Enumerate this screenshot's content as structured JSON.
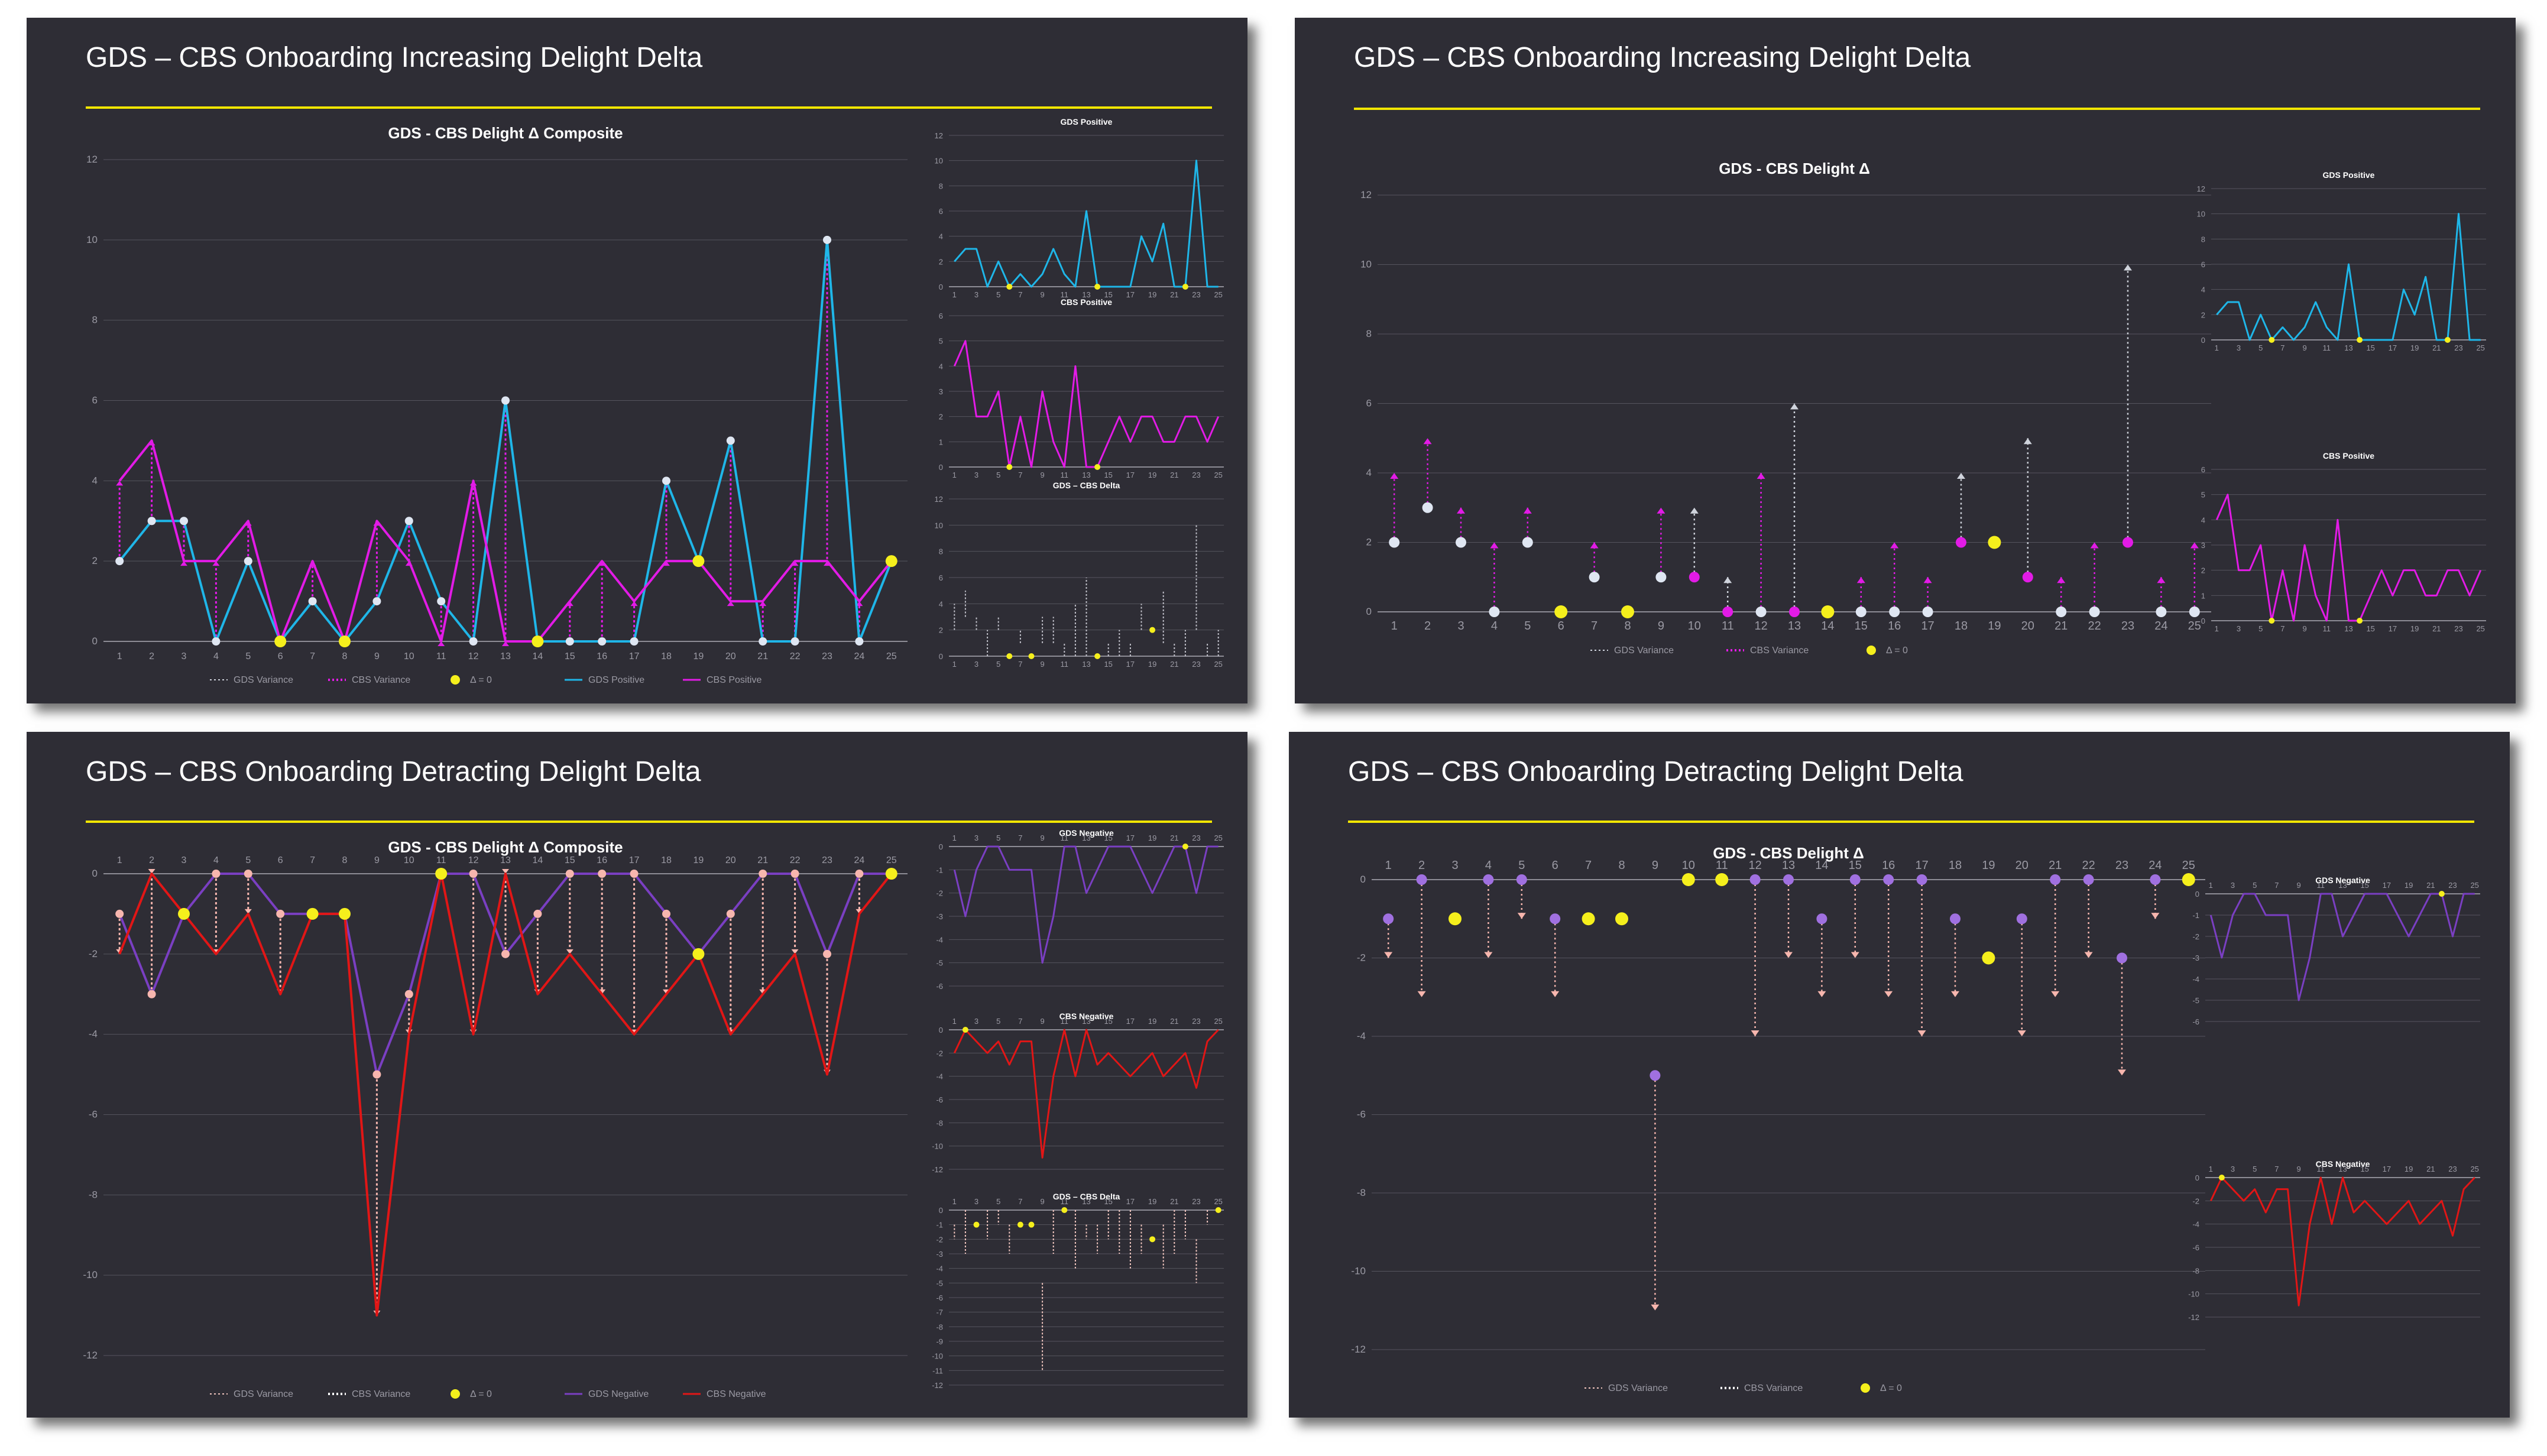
{
  "series_x": [
    1,
    2,
    3,
    4,
    5,
    6,
    7,
    8,
    9,
    10,
    11,
    12,
    13,
    14,
    15,
    16,
    17,
    18,
    19,
    20,
    21,
    22,
    23,
    24,
    25
  ],
  "series_x_odd": [
    1,
    3,
    5,
    7,
    9,
    11,
    13,
    15,
    17,
    19,
    21,
    23,
    25
  ],
  "colors": {
    "slide_bg": "#2e2d35",
    "rule": "#f2e600",
    "gds_positive": "#1fb6e8",
    "cbs_positive": "#e21be6",
    "gds_negative": "#7a3fc2",
    "cbs_negative": "#e11616",
    "zero_marker": "#f5ef1c",
    "gds_dot_pos": "#dfe6f2",
    "gds_dot_neg": "#f7b6ae",
    "cbs_dot_neg": "#a070e0",
    "grid": "#55545e",
    "axis_text": "#9b9aa4",
    "chart_title": "#ffffff"
  },
  "slides": [
    {
      "title": "GDS – CBS Onboarding Increasing Delight Delta"
    },
    {
      "title": "GDS – CBS Onboarding Increasing Delight Delta"
    },
    {
      "title": "GDS – CBS Onboarding Detracting Delight Delta"
    },
    {
      "title": "GDS – CBS Onboarding Detracting Delight Delta"
    }
  ],
  "legend": {
    "gds_variance": "GDS Variance",
    "cbs_variance": "CBS Variance",
    "delta_zero": "Δ = 0",
    "gds_positive": "GDS Positive",
    "cbs_positive": "CBS Positive",
    "gds_negative": "GDS Negative",
    "cbs_negative": "CBS Negative"
  },
  "chart_data": [
    {
      "id": "s1_main",
      "type": "line",
      "title": "GDS - CBS Delight Δ Composite",
      "x": [
        1,
        2,
        3,
        4,
        5,
        6,
        7,
        8,
        9,
        10,
        11,
        12,
        13,
        14,
        15,
        16,
        17,
        18,
        19,
        20,
        21,
        22,
        23,
        24,
        25
      ],
      "ylim": [
        0,
        12
      ],
      "yticks": [
        0,
        2,
        4,
        6,
        8,
        10,
        12
      ],
      "grid": true,
      "legend": "bottom",
      "series": [
        {
          "name": "GDS Positive",
          "values": [
            2,
            3,
            3,
            0,
            2,
            0,
            1,
            0,
            1,
            3,
            1,
            0,
            6,
            0,
            0,
            0,
            0,
            4,
            2,
            5,
            0,
            0,
            10,
            0,
            2
          ]
        },
        {
          "name": "CBS Positive",
          "values": [
            4,
            5,
            2,
            2,
            3,
            0,
            2,
            0,
            3,
            2,
            0,
            4,
            0,
            0,
            1,
            2,
            1,
            2,
            2,
            1,
            1,
            2,
            2,
            1,
            2
          ]
        }
      ]
    },
    {
      "id": "s1_small_gds",
      "type": "line",
      "title": "GDS Positive",
      "x": [
        1,
        2,
        3,
        4,
        5,
        6,
        7,
        8,
        9,
        10,
        11,
        12,
        13,
        14,
        15,
        16,
        17,
        18,
        19,
        20,
        21,
        22,
        23,
        24,
        25
      ],
      "ylim": [
        0,
        12
      ],
      "yticks": [
        0,
        2,
        4,
        6,
        8,
        10,
        12
      ],
      "series": [
        {
          "name": "GDS Positive",
          "values": [
            2,
            3,
            3,
            0,
            2,
            0,
            1,
            0,
            1,
            3,
            1,
            0,
            6,
            0,
            0,
            0,
            0,
            4,
            2,
            5,
            0,
            0,
            10,
            0,
            0
          ]
        }
      ]
    },
    {
      "id": "s1_small_cbs",
      "type": "line",
      "title": "CBS Positive",
      "x": [
        1,
        2,
        3,
        4,
        5,
        6,
        7,
        8,
        9,
        10,
        11,
        12,
        13,
        14,
        15,
        16,
        17,
        18,
        19,
        20,
        21,
        22,
        23,
        24,
        25
      ],
      "ylim": [
        0,
        6
      ],
      "yticks": [
        0,
        1,
        2,
        3,
        4,
        5,
        6
      ],
      "series": [
        {
          "name": "CBS Positive",
          "values": [
            4,
            5,
            2,
            2,
            3,
            0,
            2,
            0,
            3,
            1,
            0,
            4,
            0,
            0,
            1,
            2,
            1,
            2,
            2,
            1,
            1,
            2,
            2,
            1,
            2
          ]
        }
      ]
    },
    {
      "id": "s1_small_delta",
      "type": "scatter",
      "title": "GDS – CBS Delta",
      "x": [
        1,
        2,
        3,
        4,
        5,
        6,
        7,
        8,
        9,
        10,
        11,
        12,
        13,
        14,
        15,
        16,
        17,
        18,
        19,
        20,
        21,
        22,
        23,
        24,
        25
      ],
      "ylim": [
        0,
        12
      ],
      "yticks": [
        0,
        2,
        4,
        6,
        8,
        10,
        12
      ],
      "gds": [
        2,
        3,
        2,
        0,
        2,
        0,
        1,
        0,
        1,
        1,
        0,
        0,
        0,
        0,
        0,
        0,
        0,
        2,
        2,
        1,
        0,
        0,
        2,
        0,
        0
      ],
      "cbs": [
        4,
        5,
        3,
        2,
        3,
        0,
        2,
        0,
        3,
        3,
        1,
        4,
        6,
        0,
        1,
        2,
        1,
        4,
        2,
        5,
        1,
        2,
        10,
        1,
        2
      ]
    },
    {
      "id": "s2_main",
      "type": "scatter",
      "title": "GDS - CBS Delight Δ",
      "x": [
        1,
        2,
        3,
        4,
        5,
        6,
        7,
        8,
        9,
        10,
        11,
        12,
        13,
        14,
        15,
        16,
        17,
        18,
        19,
        20,
        21,
        22,
        23,
        24,
        25
      ],
      "ylim": [
        0,
        12
      ],
      "yticks": [
        0,
        2,
        4,
        6,
        8,
        10,
        12
      ],
      "grid": true,
      "legend": "bottom",
      "start": [
        2,
        3,
        2,
        0,
        2,
        0,
        1,
        0,
        1,
        1,
        0,
        0,
        0,
        0,
        0,
        0,
        0,
        2,
        2,
        1,
        0,
        0,
        2,
        0,
        0
      ],
      "end": [
        4,
        5,
        3,
        2,
        3,
        0,
        2,
        0,
        3,
        3,
        1,
        4,
        6,
        0,
        1,
        2,
        1,
        4,
        2,
        5,
        1,
        2,
        10,
        1,
        2
      ]
    },
    {
      "id": "s2_small_gds",
      "type": "line",
      "title": "GDS Positive",
      "x": [
        1,
        2,
        3,
        4,
        5,
        6,
        7,
        8,
        9,
        10,
        11,
        12,
        13,
        14,
        15,
        16,
        17,
        18,
        19,
        20,
        21,
        22,
        23,
        24,
        25
      ],
      "ylim": [
        0,
        12
      ],
      "yticks": [
        0,
        2,
        4,
        6,
        8,
        10,
        12
      ],
      "series": [
        {
          "name": "GDS Positive",
          "values": [
            2,
            3,
            3,
            0,
            2,
            0,
            1,
            0,
            1,
            3,
            1,
            0,
            6,
            0,
            0,
            0,
            0,
            4,
            2,
            5,
            0,
            0,
            10,
            0,
            0
          ]
        }
      ]
    },
    {
      "id": "s2_small_cbs",
      "type": "line",
      "title": "CBS Positive",
      "x": [
        1,
        2,
        3,
        4,
        5,
        6,
        7,
        8,
        9,
        10,
        11,
        12,
        13,
        14,
        15,
        16,
        17,
        18,
        19,
        20,
        21,
        22,
        23,
        24,
        25
      ],
      "ylim": [
        0,
        6
      ],
      "yticks": [
        0,
        1,
        2,
        3,
        4,
        5,
        6
      ],
      "series": [
        {
          "name": "CBS Positive",
          "values": [
            4,
            5,
            2,
            2,
            3,
            0,
            2,
            0,
            3,
            1,
            0,
            4,
            0,
            0,
            1,
            2,
            1,
            2,
            2,
            1,
            1,
            2,
            2,
            1,
            2
          ]
        }
      ]
    },
    {
      "id": "s3_main",
      "type": "line",
      "title": "GDS - CBS  Delight Δ Composite",
      "x": [
        1,
        2,
        3,
        4,
        5,
        6,
        7,
        8,
        9,
        10,
        11,
        12,
        13,
        14,
        15,
        16,
        17,
        18,
        19,
        20,
        21,
        22,
        23,
        24,
        25
      ],
      "ylim": [
        -12,
        0
      ],
      "yticks": [
        0,
        -2,
        -4,
        -6,
        -8,
        -10,
        -12
      ],
      "grid": true,
      "legend": "bottom",
      "series": [
        {
          "name": "GDS Negative",
          "values": [
            -1,
            -3,
            -1,
            0,
            0,
            -1,
            -1,
            -1,
            -5,
            -3,
            0,
            0,
            -2,
            -1,
            0,
            0,
            0,
            -1,
            -2,
            -1,
            0,
            0,
            -2,
            0,
            0
          ]
        },
        {
          "name": "CBS Negative",
          "values": [
            -2,
            0,
            -1,
            -2,
            -1,
            -3,
            -1,
            -1,
            -11,
            -4,
            0,
            -4,
            0,
            -3,
            -2,
            -3,
            -4,
            -3,
            -2,
            -4,
            -3,
            -2,
            -5,
            -1,
            0
          ]
        }
      ]
    },
    {
      "id": "s3_small_gds",
      "type": "line",
      "title": "GDS Negative",
      "x": [
        1,
        2,
        3,
        4,
        5,
        6,
        7,
        8,
        9,
        10,
        11,
        12,
        13,
        14,
        15,
        16,
        17,
        18,
        19,
        20,
        21,
        22,
        23,
        24,
        25
      ],
      "ylim": [
        -6,
        0
      ],
      "yticks": [
        0,
        -1,
        -2,
        -3,
        -4,
        -5,
        -6
      ],
      "series": [
        {
          "name": "GDS Negative",
          "values": [
            -1,
            -3,
            -1,
            0,
            0,
            -1,
            -1,
            -1,
            -5,
            -3,
            0,
            0,
            -2,
            -1,
            0,
            0,
            0,
            -1,
            -2,
            -1,
            0,
            0,
            -2,
            0,
            0
          ]
        }
      ]
    },
    {
      "id": "s3_small_cbs",
      "type": "line",
      "title": "CBS Negative",
      "x": [
        1,
        2,
        3,
        4,
        5,
        6,
        7,
        8,
        9,
        10,
        11,
        12,
        13,
        14,
        15,
        16,
        17,
        18,
        19,
        20,
        21,
        22,
        23,
        24,
        25
      ],
      "ylim": [
        -12,
        0
      ],
      "yticks": [
        0,
        -2,
        -4,
        -6,
        -8,
        -10,
        -12
      ],
      "series": [
        {
          "name": "CBS Negative",
          "values": [
            -2,
            0,
            -1,
            -2,
            -1,
            -3,
            -1,
            -1,
            -11,
            -4,
            0,
            -4,
            0,
            -3,
            -2,
            -3,
            -4,
            -3,
            -2,
            -4,
            -3,
            -2,
            -5,
            -1,
            0
          ]
        }
      ]
    },
    {
      "id": "s3_small_delta",
      "type": "scatter",
      "title": "GDS – CBS Delta",
      "x": [
        1,
        2,
        3,
        4,
        5,
        6,
        7,
        8,
        9,
        10,
        11,
        12,
        13,
        14,
        15,
        16,
        17,
        18,
        19,
        20,
        21,
        22,
        23,
        24,
        25
      ],
      "ylim": [
        -12,
        0
      ],
      "yticks": [
        0,
        -1,
        -2,
        -3,
        -4,
        -5,
        -6,
        -7,
        -8,
        -9,
        -10,
        -11,
        -12
      ],
      "gds": [
        -1,
        0,
        -1,
        0,
        0,
        -1,
        -1,
        -1,
        -5,
        0,
        0,
        0,
        -1,
        -1,
        0,
        0,
        0,
        -1,
        -2,
        -1,
        0,
        0,
        -2,
        0,
        0
      ],
      "cbs": [
        -2,
        -3,
        -1,
        -2,
        -1,
        -3,
        -1,
        -1,
        -11,
        -3,
        0,
        -4,
        -2,
        -3,
        -2,
        -3,
        -4,
        -3,
        -2,
        -4,
        -3,
        -2,
        -5,
        -1,
        0
      ]
    },
    {
      "id": "s4_main",
      "type": "scatter",
      "title": "GDS - CBS  Delight Δ",
      "x": [
        1,
        2,
        3,
        4,
        5,
        6,
        7,
        8,
        9,
        10,
        11,
        12,
        13,
        14,
        15,
        16,
        17,
        18,
        19,
        20,
        21,
        22,
        23,
        24,
        25
      ],
      "ylim": [
        -12,
        0
      ],
      "yticks": [
        0,
        -2,
        -4,
        -6,
        -8,
        -10,
        -12
      ],
      "grid": true,
      "legend": "bottom",
      "start": [
        -1,
        0,
        -1,
        0,
        0,
        -1,
        -1,
        -1,
        -5,
        0,
        0,
        0,
        0,
        -1,
        0,
        0,
        0,
        -1,
        -2,
        -1,
        0,
        0,
        -2,
        0,
        0
      ],
      "end": [
        -2,
        -3,
        -1,
        -2,
        -1,
        -3,
        -1,
        -1,
        -11,
        0,
        0,
        -4,
        -2,
        -3,
        -2,
        -3,
        -4,
        -3,
        -2,
        -4,
        -3,
        -2,
        -5,
        -1,
        0
      ]
    },
    {
      "id": "s4_small_gds",
      "type": "line",
      "title": "GDS Negative",
      "x": [
        1,
        2,
        3,
        4,
        5,
        6,
        7,
        8,
        9,
        10,
        11,
        12,
        13,
        14,
        15,
        16,
        17,
        18,
        19,
        20,
        21,
        22,
        23,
        24,
        25
      ],
      "ylim": [
        -6,
        0
      ],
      "yticks": [
        0,
        -1,
        -2,
        -3,
        -4,
        -5,
        -6
      ],
      "series": [
        {
          "name": "GDS Negative",
          "values": [
            -1,
            -3,
            -1,
            0,
            0,
            -1,
            -1,
            -1,
            -5,
            -3,
            0,
            0,
            -2,
            -1,
            0,
            0,
            0,
            -1,
            -2,
            -1,
            0,
            0,
            -2,
            0,
            0
          ]
        }
      ]
    },
    {
      "id": "s4_small_cbs",
      "type": "line",
      "title": "CBS Negative",
      "x": [
        1,
        2,
        3,
        4,
        5,
        6,
        7,
        8,
        9,
        10,
        11,
        12,
        13,
        14,
        15,
        16,
        17,
        18,
        19,
        20,
        21,
        22,
        23,
        24,
        25
      ],
      "ylim": [
        -12,
        0
      ],
      "yticks": [
        0,
        -2,
        -4,
        -6,
        -8,
        -10,
        -12
      ],
      "series": [
        {
          "name": "CBS Negative",
          "values": [
            -2,
            0,
            -1,
            -2,
            -1,
            -3,
            -1,
            -1,
            -11,
            -4,
            0,
            -4,
            0,
            -3,
            -2,
            -3,
            -4,
            -3,
            -2,
            -4,
            -3,
            -2,
            -5,
            -1,
            0
          ]
        }
      ]
    }
  ]
}
